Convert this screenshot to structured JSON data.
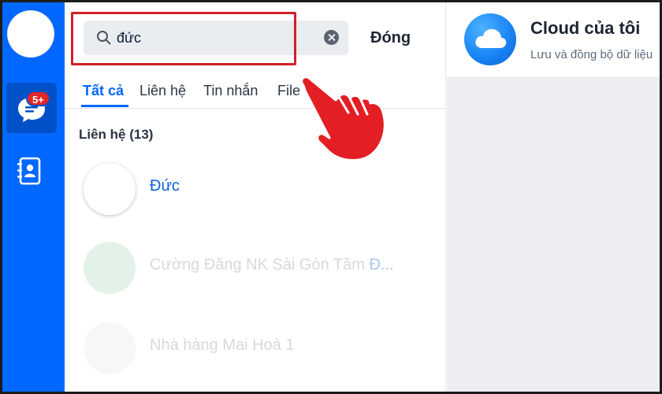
{
  "rail": {
    "badge": "5+"
  },
  "search": {
    "value": "đức",
    "close_label": "Đóng"
  },
  "tabs": [
    {
      "label": "Tất cả",
      "active": true
    },
    {
      "label": "Liên hệ",
      "active": false
    },
    {
      "label": "Tin nhắn",
      "active": false
    },
    {
      "label": "File",
      "active": false
    }
  ],
  "results": {
    "section_title": "Liên hệ (13)",
    "contacts": [
      {
        "name": "Đức"
      },
      {
        "name_prefix": "Cường Đăng NK Sài Gòn Tâm ",
        "name_highlight": "Đ..."
      },
      {
        "name": "Nhà hàng Mai Hoà 1"
      }
    ]
  },
  "cloud": {
    "title": "Cloud của tôi",
    "subtitle": "Lưu và đồng bộ dữ liệu"
  },
  "colors": {
    "accent": "#0068ff",
    "badge": "#e0262b",
    "highlight_box": "#d0202a"
  }
}
